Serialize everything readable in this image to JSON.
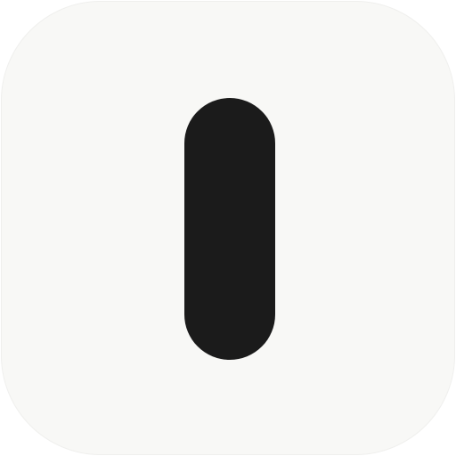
{
  "app_icon": {
    "icon_name": "rounded-pill-icon",
    "colors": {
      "tile": "#f8f8f6",
      "glyph": "#1b1b1b"
    }
  }
}
